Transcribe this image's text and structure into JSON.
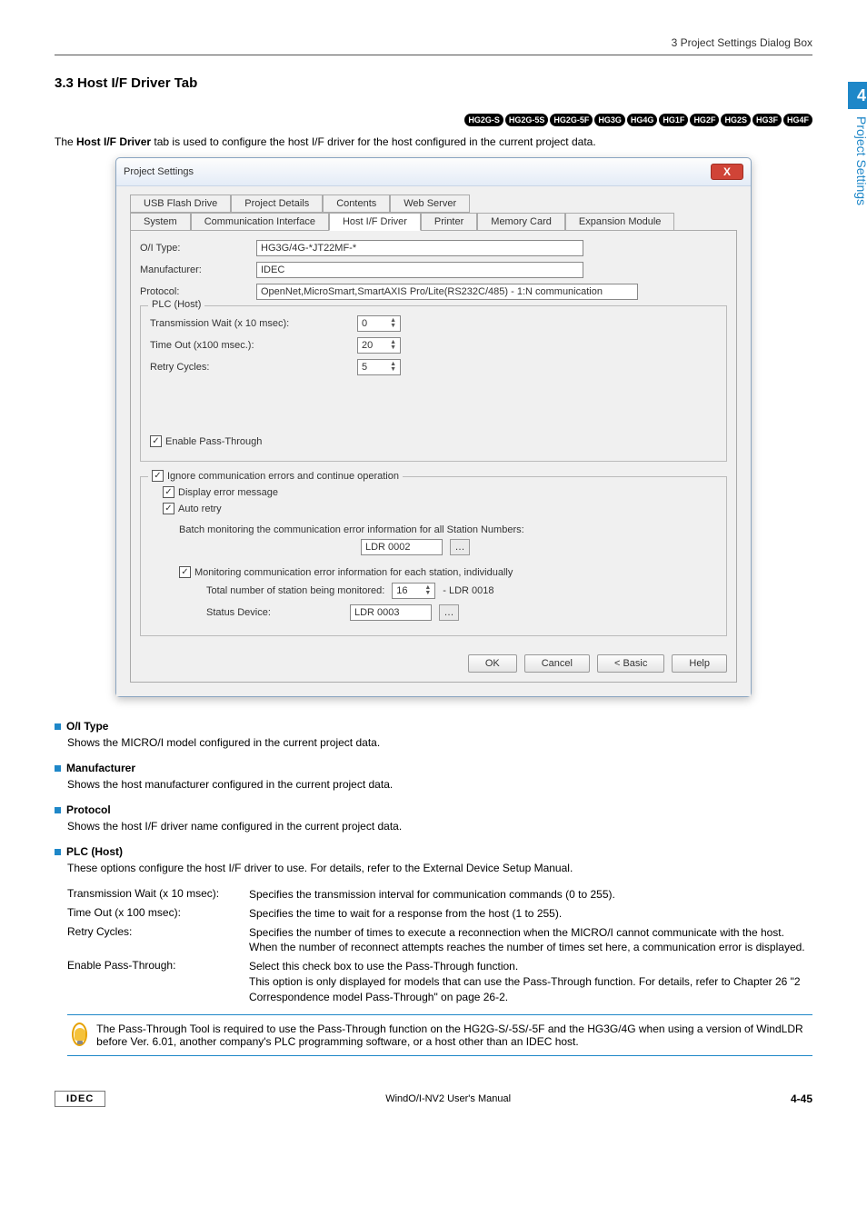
{
  "header": {
    "breadcrumb": "3 Project Settings Dialog Box"
  },
  "sidetab": {
    "number": "4",
    "text": "Project Settings"
  },
  "section": {
    "number_title": "3.3  Host I/F Driver Tab"
  },
  "badges": [
    "HG2G-S",
    "HG2G-5S",
    "HG2G-5F",
    "HG3G",
    "HG4G",
    "HG1F",
    "HG2F",
    "HG2S",
    "HG3F",
    "HG4F"
  ],
  "intro_before_bold": "The ",
  "intro_bold": "Host I/F Driver",
  "intro_after_bold": " tab is used to configure the host I/F driver for the host configured in the current project data.",
  "dialog": {
    "title": "Project Settings",
    "close_x": "X",
    "tabs_row1": [
      "USB Flash Drive",
      "Project Details",
      "Contents",
      "Web Server"
    ],
    "tabs_row2": [
      "System",
      "Communication Interface",
      "Host I/F Driver",
      "Printer",
      "Memory Card",
      "Expansion Module"
    ],
    "active_tab": "Host I/F Driver",
    "oi_type_label": "O/I Type:",
    "oi_type_value": "HG3G/4G-*JT22MF-*",
    "manufacturer_label": "Manufacturer:",
    "manufacturer_value": "IDEC",
    "protocol_label": "Protocol:",
    "protocol_value": "OpenNet,MicroSmart,SmartAXIS Pro/Lite(RS232C/485) - 1:N communication",
    "plc_group": "PLC (Host)",
    "trans_wait_label": "Transmission Wait (x 10 msec):",
    "trans_wait_value": "0",
    "timeout_label": "Time Out (x100 msec.):",
    "timeout_value": "20",
    "retry_label": "Retry Cycles:",
    "retry_value": "5",
    "enable_pt": "Enable Pass-Through",
    "ignore": "Ignore communication errors and continue operation",
    "display_err": "Display error message",
    "auto_retry": "Auto retry",
    "batch_label": "Batch monitoring the communication error information for all Station Numbers:",
    "batch_value": "LDR 0002",
    "monitor": "Monitoring communication error information for each station, individually",
    "total_label": "Total number of station being monitored:",
    "total_value": "16",
    "total_tail": "- LDR 0018",
    "status_label": "Status Device:",
    "status_value": "LDR 0003",
    "buttons": {
      "ok": "OK",
      "cancel": "Cancel",
      "basic": "< Basic",
      "help": "Help"
    }
  },
  "defs": {
    "oi_type": {
      "title": "O/I Type",
      "body": "Shows the MICRO/I model configured in the current project data."
    },
    "manufacturer": {
      "title": "Manufacturer",
      "body": "Shows the host manufacturer configured in the current project data."
    },
    "protocol": {
      "title": "Protocol",
      "body": "Shows the host I/F driver name configured in the current project data."
    },
    "plc": {
      "title": "PLC (Host)",
      "body": "These options configure the host I/F driver to use. For details, refer to the External Device Setup Manual.",
      "rows": {
        "trans_wait": {
          "k": "Transmission Wait (x 10 msec):",
          "v": "Specifies the transmission interval for communication commands (0 to 255)."
        },
        "timeout": {
          "k": "Time Out (x 100 msec):",
          "v": "Specifies the time to wait for a response from the host (1 to 255)."
        },
        "retry": {
          "k": "Retry Cycles:",
          "v": "Specifies the number of times to execute a reconnection when the MICRO/I cannot communicate with the host. When the number of reconnect attempts reaches the number of times set here, a communication error is displayed."
        },
        "ept": {
          "k": "Enable Pass-Through:",
          "v1": "Select this check box to use the Pass-Through function.",
          "v2": "This option is only displayed for models that can use the Pass-Through function. For details, refer to Chapter 26 \"2 Correspondence model Pass-Through\" on page 26-2."
        }
      }
    }
  },
  "note": "The Pass-Through Tool is required to use the Pass-Through function on the HG2G-S/-5S/-5F and the HG3G/4G when using a version of WindLDR before Ver. 6.01, another company's PLC programming software, or a host other than an IDEC host.",
  "footer": {
    "brand": "IDEC",
    "center": "WindO/I-NV2 User's Manual",
    "page": "4-45"
  }
}
